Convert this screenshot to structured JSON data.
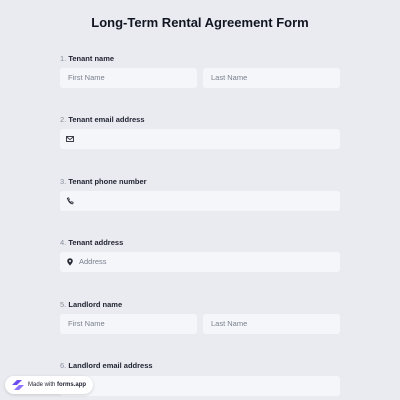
{
  "form": {
    "title": "Long-Term Rental Agreement Form"
  },
  "questions": [
    {
      "number": "1.",
      "label": "Tenant name",
      "placeholders": [
        "First Name",
        "Last Name"
      ]
    },
    {
      "number": "2.",
      "label": "Tenant email address",
      "icon": "envelope-icon",
      "placeholder": ""
    },
    {
      "number": "3.",
      "label": "Tenant phone number",
      "icon": "phone-icon",
      "placeholder": ""
    },
    {
      "number": "4.",
      "label": "Tenant address",
      "icon": "location-pin-icon",
      "placeholder": "Address"
    },
    {
      "number": "5.",
      "label": "Landlord name",
      "placeholders": [
        "First Name",
        "Last Name"
      ]
    },
    {
      "number": "6.",
      "label": "Landlord email address",
      "placeholder": ""
    }
  ],
  "badge": {
    "prefix": "Made with",
    "brand": "forms.app"
  },
  "colors": {
    "background": "#e9ebf0",
    "field": "#f4f6fa",
    "brand_purple": "#6c4df2"
  }
}
